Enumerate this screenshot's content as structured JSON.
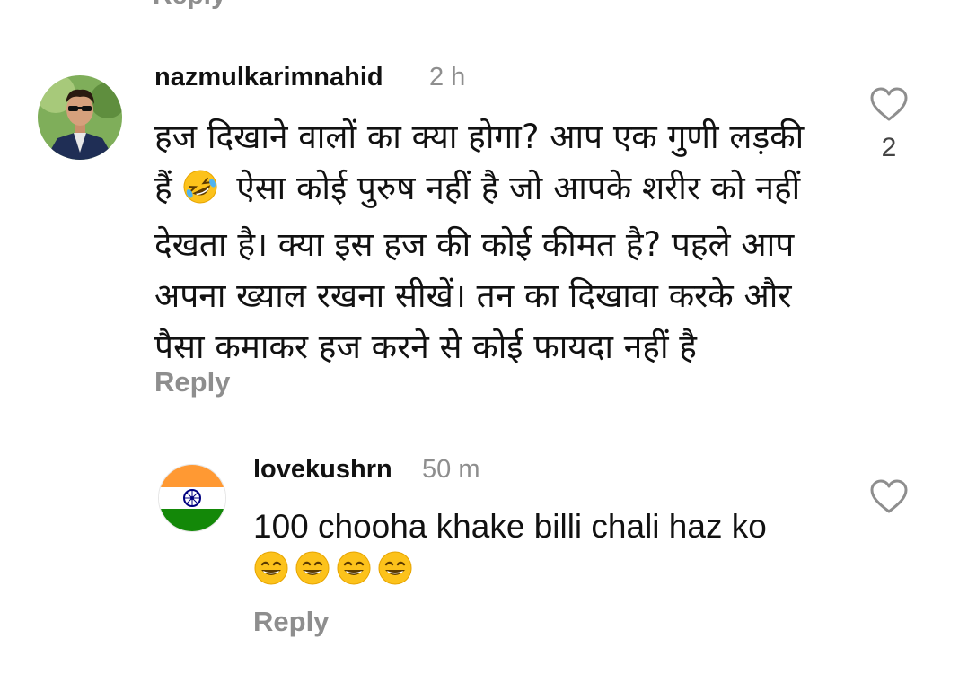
{
  "cut_text": "Reply",
  "comments": [
    {
      "username": "nazmulkarimnahid",
      "time": "2 h",
      "lines": [
        "हज दिखाने वालों का क्या होगा? आप एक गुणी लड़की",
        "हैं",
        "ऐसा कोई पुरुष नहीं है जो आपके शरीर को नहीं",
        "देखता है। क्या इस हज की कोई कीमत है? पहले आप",
        "अपना ख्याल रखना सीखें। तन का दिखावा करके और",
        "पैसा कमाकर हज करने से कोई फायदा नहीं है"
      ],
      "inline_emoji": "rolling-on-floor-laughing-emoji",
      "reply_label": "Reply",
      "like_count": "2",
      "heart_icon": "heart-outline-icon"
    },
    {
      "username": "lovekushrn",
      "time": "50 m",
      "text": "100 chooha khake billi chali haz ko",
      "emojis": [
        "grinning-squinting-emoji",
        "grinning-squinting-emoji",
        "grinning-squinting-emoji",
        "grinning-squinting-emoji"
      ],
      "reply_label": "Reply",
      "heart_icon": "heart-outline-icon"
    }
  ],
  "colors": {
    "text": "#111111",
    "muted": "#8e8e8e",
    "saffron": "#ff9933",
    "green": "#138808",
    "navy": "#000080"
  }
}
